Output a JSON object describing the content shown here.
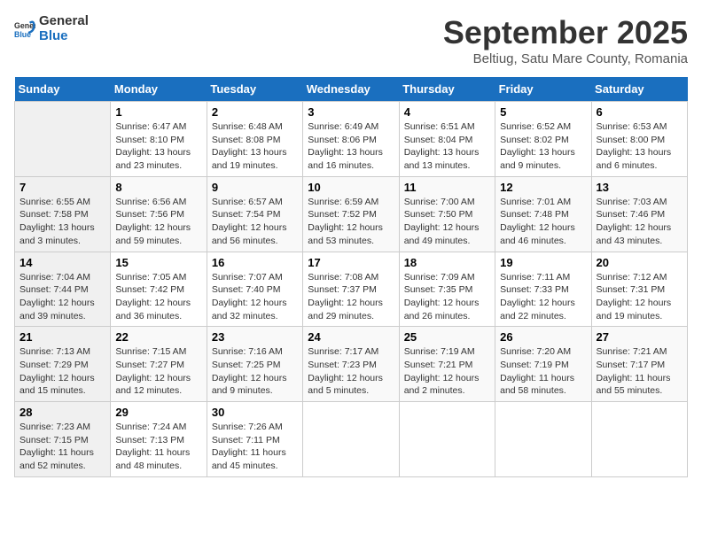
{
  "logo": {
    "text_general": "General",
    "text_blue": "Blue"
  },
  "title": {
    "month": "September 2025",
    "location": "Beltiug, Satu Mare County, Romania"
  },
  "headers": [
    "Sunday",
    "Monday",
    "Tuesday",
    "Wednesday",
    "Thursday",
    "Friday",
    "Saturday"
  ],
  "weeks": [
    [
      {
        "day": "",
        "info": ""
      },
      {
        "day": "1",
        "info": "Sunrise: 6:47 AM\nSunset: 8:10 PM\nDaylight: 13 hours\nand 23 minutes."
      },
      {
        "day": "2",
        "info": "Sunrise: 6:48 AM\nSunset: 8:08 PM\nDaylight: 13 hours\nand 19 minutes."
      },
      {
        "day": "3",
        "info": "Sunrise: 6:49 AM\nSunset: 8:06 PM\nDaylight: 13 hours\nand 16 minutes."
      },
      {
        "day": "4",
        "info": "Sunrise: 6:51 AM\nSunset: 8:04 PM\nDaylight: 13 hours\nand 13 minutes."
      },
      {
        "day": "5",
        "info": "Sunrise: 6:52 AM\nSunset: 8:02 PM\nDaylight: 13 hours\nand 9 minutes."
      },
      {
        "day": "6",
        "info": "Sunrise: 6:53 AM\nSunset: 8:00 PM\nDaylight: 13 hours\nand 6 minutes."
      }
    ],
    [
      {
        "day": "7",
        "info": "Sunrise: 6:55 AM\nSunset: 7:58 PM\nDaylight: 13 hours\nand 3 minutes."
      },
      {
        "day": "8",
        "info": "Sunrise: 6:56 AM\nSunset: 7:56 PM\nDaylight: 12 hours\nand 59 minutes."
      },
      {
        "day": "9",
        "info": "Sunrise: 6:57 AM\nSunset: 7:54 PM\nDaylight: 12 hours\nand 56 minutes."
      },
      {
        "day": "10",
        "info": "Sunrise: 6:59 AM\nSunset: 7:52 PM\nDaylight: 12 hours\nand 53 minutes."
      },
      {
        "day": "11",
        "info": "Sunrise: 7:00 AM\nSunset: 7:50 PM\nDaylight: 12 hours\nand 49 minutes."
      },
      {
        "day": "12",
        "info": "Sunrise: 7:01 AM\nSunset: 7:48 PM\nDaylight: 12 hours\nand 46 minutes."
      },
      {
        "day": "13",
        "info": "Sunrise: 7:03 AM\nSunset: 7:46 PM\nDaylight: 12 hours\nand 43 minutes."
      }
    ],
    [
      {
        "day": "14",
        "info": "Sunrise: 7:04 AM\nSunset: 7:44 PM\nDaylight: 12 hours\nand 39 minutes."
      },
      {
        "day": "15",
        "info": "Sunrise: 7:05 AM\nSunset: 7:42 PM\nDaylight: 12 hours\nand 36 minutes."
      },
      {
        "day": "16",
        "info": "Sunrise: 7:07 AM\nSunset: 7:40 PM\nDaylight: 12 hours\nand 32 minutes."
      },
      {
        "day": "17",
        "info": "Sunrise: 7:08 AM\nSunset: 7:37 PM\nDaylight: 12 hours\nand 29 minutes."
      },
      {
        "day": "18",
        "info": "Sunrise: 7:09 AM\nSunset: 7:35 PM\nDaylight: 12 hours\nand 26 minutes."
      },
      {
        "day": "19",
        "info": "Sunrise: 7:11 AM\nSunset: 7:33 PM\nDaylight: 12 hours\nand 22 minutes."
      },
      {
        "day": "20",
        "info": "Sunrise: 7:12 AM\nSunset: 7:31 PM\nDaylight: 12 hours\nand 19 minutes."
      }
    ],
    [
      {
        "day": "21",
        "info": "Sunrise: 7:13 AM\nSunset: 7:29 PM\nDaylight: 12 hours\nand 15 minutes."
      },
      {
        "day": "22",
        "info": "Sunrise: 7:15 AM\nSunset: 7:27 PM\nDaylight: 12 hours\nand 12 minutes."
      },
      {
        "day": "23",
        "info": "Sunrise: 7:16 AM\nSunset: 7:25 PM\nDaylight: 12 hours\nand 9 minutes."
      },
      {
        "day": "24",
        "info": "Sunrise: 7:17 AM\nSunset: 7:23 PM\nDaylight: 12 hours\nand 5 minutes."
      },
      {
        "day": "25",
        "info": "Sunrise: 7:19 AM\nSunset: 7:21 PM\nDaylight: 12 hours\nand 2 minutes."
      },
      {
        "day": "26",
        "info": "Sunrise: 7:20 AM\nSunset: 7:19 PM\nDaylight: 11 hours\nand 58 minutes."
      },
      {
        "day": "27",
        "info": "Sunrise: 7:21 AM\nSunset: 7:17 PM\nDaylight: 11 hours\nand 55 minutes."
      }
    ],
    [
      {
        "day": "28",
        "info": "Sunrise: 7:23 AM\nSunset: 7:15 PM\nDaylight: 11 hours\nand 52 minutes."
      },
      {
        "day": "29",
        "info": "Sunrise: 7:24 AM\nSunset: 7:13 PM\nDaylight: 11 hours\nand 48 minutes."
      },
      {
        "day": "30",
        "info": "Sunrise: 7:26 AM\nSunset: 7:11 PM\nDaylight: 11 hours\nand 45 minutes."
      },
      {
        "day": "",
        "info": ""
      },
      {
        "day": "",
        "info": ""
      },
      {
        "day": "",
        "info": ""
      },
      {
        "day": "",
        "info": ""
      }
    ]
  ]
}
